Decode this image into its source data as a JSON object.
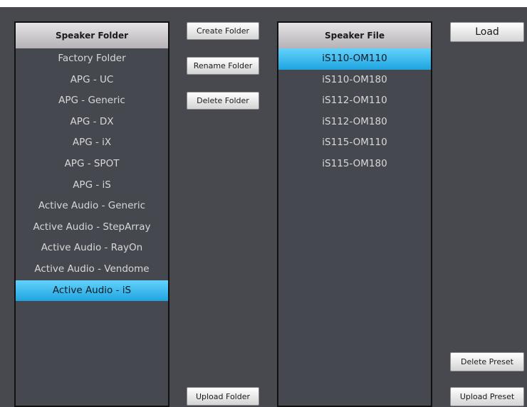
{
  "speaker_folder": {
    "header": "Speaker Folder",
    "items": [
      "Factory Folder",
      "APG - UC",
      "APG - Generic",
      "APG - DX",
      "APG - iX",
      "APG - SPOT",
      "APG - iS",
      "Active Audio - Generic",
      "Active Audio - StepArray",
      "Active Audio - RayOn",
      "Active Audio - Vendome",
      "Active Audio - iS"
    ],
    "selected_index": 11
  },
  "speaker_file": {
    "header": "Speaker File",
    "items": [
      "iS110-OM110",
      "iS110-OM180",
      "iS112-OM110",
      "iS112-OM180",
      "iS115-OM110",
      "iS115-OM180"
    ],
    "selected_index": 0
  },
  "buttons": {
    "create_folder": "Create Folder",
    "rename_folder": "Rename Folder",
    "delete_folder": "Delete Folder",
    "upload_folder": "Upload Folder",
    "load": "Load",
    "delete_preset": "Delete Preset",
    "upload_preset": "Upload Preset"
  },
  "colors": {
    "background": "#47494f",
    "selection": "#2db4ee",
    "header": "#d2cfd3"
  }
}
